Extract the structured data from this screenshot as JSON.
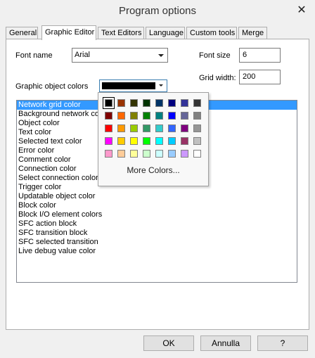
{
  "window": {
    "title": "Program options",
    "close_glyph": "✕"
  },
  "tabs": [
    {
      "label": "General",
      "active": false
    },
    {
      "label": "Graphic Editor",
      "active": true
    },
    {
      "label": "Text Editors",
      "active": false
    },
    {
      "label": "Language",
      "active": false
    },
    {
      "label": "Custom tools",
      "active": false
    },
    {
      "label": "Merge",
      "active": false
    }
  ],
  "font": {
    "label": "Font name",
    "value": "Arial"
  },
  "font_size": {
    "label": "Font size",
    "value": "6"
  },
  "grid_width": {
    "label": "Grid width:",
    "value": "200"
  },
  "graphic_colors": {
    "label": "Graphic object colors",
    "selected_color": "#000000"
  },
  "list": {
    "selected_index": 0,
    "items": [
      "Network grid color",
      "Background network color",
      "Object color",
      "Text color",
      "Selected text color",
      "Error color",
      "Comment color",
      "Connection color",
      "Select connection color",
      "Trigger color",
      "Updatable object color",
      "Block color",
      "Block I/O element colors",
      "SFC action block",
      "SFC transition block",
      "SFC selected transition",
      "Live debug value color"
    ]
  },
  "color_popup": {
    "more_label": "More Colors...",
    "selected": [
      0,
      0
    ],
    "rows": [
      [
        "#000000",
        "#993300",
        "#333300",
        "#003300",
        "#003366",
        "#000080",
        "#333399",
        "#333333"
      ],
      [
        "#800000",
        "#ff6600",
        "#808000",
        "#008000",
        "#008080",
        "#0000ff",
        "#666699",
        "#808080"
      ],
      [
        "#ff0000",
        "#ff9900",
        "#99cc00",
        "#339966",
        "#33cccc",
        "#3366ff",
        "#800080",
        "#969696"
      ],
      [
        "#ff00ff",
        "#ffcc00",
        "#ffff00",
        "#00ff00",
        "#00ffff",
        "#00ccff",
        "#993366",
        "#c0c0c0"
      ],
      [
        "#ff99cc",
        "#ffcc99",
        "#ffff99",
        "#ccffcc",
        "#ccffff",
        "#99ccff",
        "#cc99ff",
        "#ffffff"
      ]
    ]
  },
  "buttons": {
    "ok": "OK",
    "cancel": "Annulla",
    "help": "?"
  }
}
